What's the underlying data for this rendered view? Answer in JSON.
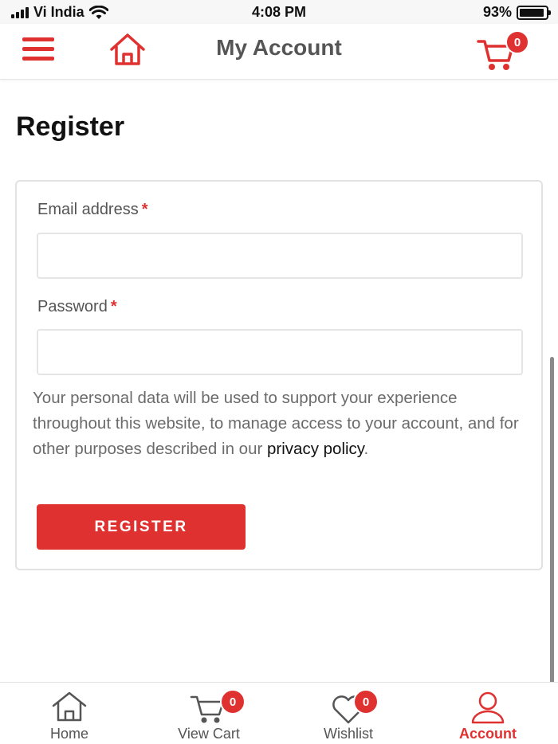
{
  "status_bar": {
    "carrier": "Vi India",
    "time": "4:08 PM",
    "battery_percent": "93%",
    "battery_level": 0.93
  },
  "header": {
    "title": "My Account",
    "cart_count": "0"
  },
  "page": {
    "title": "Register"
  },
  "form": {
    "email_label": "Email address",
    "email_required": "*",
    "email_value": "",
    "password_label": "Password",
    "password_required": "*",
    "password_value": "",
    "privacy_text": "Your personal data will be used to support your experience throughout this website, to manage access to your account, and for other purposes described in our",
    "privacy_link": "privacy policy",
    "privacy_end": ".",
    "register_label": "REGISTER"
  },
  "bottom_nav": {
    "items": [
      {
        "label": "Home",
        "icon": "home-icon"
      },
      {
        "label": "View Cart",
        "icon": "cart-icon",
        "badge": "0"
      },
      {
        "label": "Wishlist",
        "icon": "heart-icon",
        "badge": "0"
      },
      {
        "label": "Account",
        "icon": "user-icon",
        "active": true
      }
    ]
  },
  "colors": {
    "accent": "#e03131",
    "text_muted": "#6b6b6b",
    "border": "#e2e2e2"
  }
}
